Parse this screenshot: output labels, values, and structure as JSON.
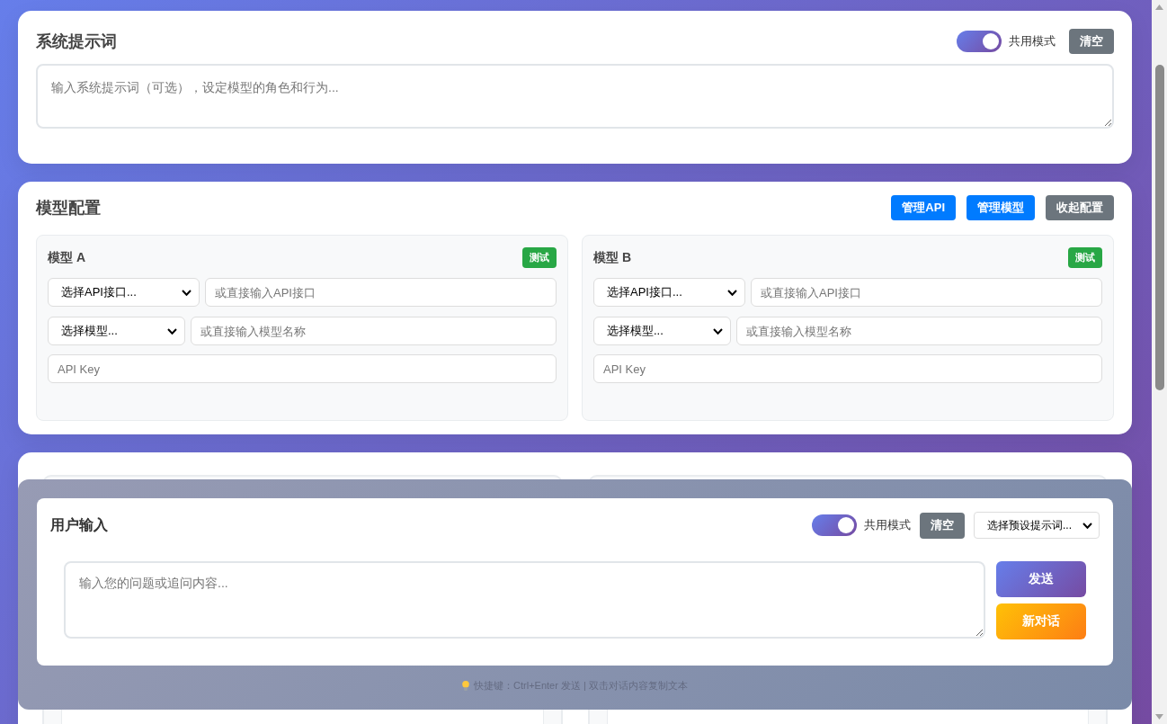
{
  "system_prompt": {
    "title": "系统提示词",
    "shared_toggle": {
      "label": "共用模式",
      "on": true
    },
    "clear_button": "清空",
    "textarea": {
      "placeholder": "输入系统提示词（可选），设定模型的角色和行为..."
    }
  },
  "model_config": {
    "title": "模型配置",
    "buttons": [
      {
        "label": "管理API",
        "kind": "primary"
      },
      {
        "label": "管理模型",
        "kind": "primary"
      },
      {
        "label": "收起配置",
        "kind": "secondary"
      }
    ],
    "models": [
      {
        "title": "模型 A",
        "test_button": "测试",
        "api_select": "选择API接口...",
        "api_input": {
          "placeholder": "或直接输入API接口"
        },
        "model_select": "选择模型...",
        "model_input": {
          "placeholder": "或直接输入模型名称"
        },
        "api_key_input": {
          "placeholder": "API Key"
        }
      },
      {
        "title": "模型 B",
        "test_button": "测试",
        "api_select": "选择API接口...",
        "api_input": {
          "placeholder": "或直接输入API接口"
        },
        "model_select": "选择模型...",
        "model_input": {
          "placeholder": "或直接输入模型名称"
        },
        "api_key_input": {
          "placeholder": "API Key"
        }
      }
    ]
  },
  "user_input": {
    "title": "用户输入",
    "shared_toggle": {
      "label": "共用模式",
      "on": true
    },
    "clear_button": "清空",
    "preset_select": "选择预设提示词...",
    "textarea": {
      "placeholder": "输入您的问题或追问内容..."
    },
    "send_button": "发送",
    "new_chat_button": "新对话",
    "hint": "快捷键：Ctrl+Enter 发送 | 双击对话内容复制文本"
  }
}
